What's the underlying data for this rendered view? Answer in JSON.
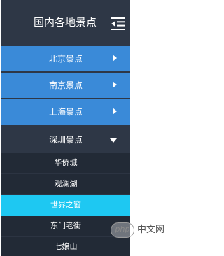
{
  "header": {
    "title": "国内各地景点",
    "menu_icon": "menu-collapse-icon"
  },
  "menu": {
    "items": [
      {
        "label": "北京景点",
        "state": "collapsed",
        "icon": "chevron-right-icon"
      },
      {
        "label": "南京景点",
        "state": "collapsed",
        "icon": "chevron-right-icon"
      },
      {
        "label": "上海景点",
        "state": "collapsed",
        "icon": "chevron-right-icon"
      },
      {
        "label": "深圳景点",
        "state": "expanded",
        "icon": "chevron-down-icon"
      }
    ],
    "sub_items": [
      {
        "label": "华侨城"
      },
      {
        "label": "观澜湖"
      },
      {
        "label": "世界之窗",
        "active": true
      },
      {
        "label": "东门老街"
      },
      {
        "label": "七娘山"
      }
    ]
  },
  "watermark": {
    "logo_text": "php",
    "site_text": "中文网"
  },
  "colors": {
    "panel_bg": "#2e3746",
    "item_bg": "#3a8ad8",
    "sub_bg": "#222a36",
    "active_bg": "#1ec8f2",
    "text": "#ffffff"
  }
}
